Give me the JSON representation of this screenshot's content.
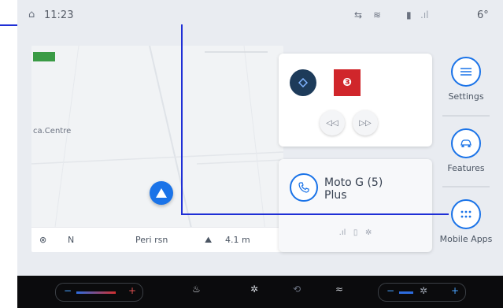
{
  "status_bar": {
    "time": "11:23",
    "temperature": "6°"
  },
  "map": {
    "city_label": "ca.Centre",
    "direction": "N",
    "street": "Peri rsn",
    "distance": "4.1 m"
  },
  "media": {
    "prev_label": "◁◁",
    "next_label": "▷▷"
  },
  "phone": {
    "device_name_line1": "Moto G (5)",
    "device_name_line2": "Plus"
  },
  "sidebar": {
    "settings": "Settings",
    "features": "Features",
    "mobile_apps": "Mobile Apps"
  },
  "colors": {
    "accent": "#1a73e8",
    "overlay": "#1f2fd6",
    "radio": "#d0262b"
  },
  "icons": [
    "home-icon",
    "signal-icon",
    "wifi-icon",
    "battery-icon",
    "phone-icon",
    "menu-icon",
    "car-icon",
    "apps-icon",
    "fan-icon",
    "seat-icon",
    "defrost-icon"
  ]
}
